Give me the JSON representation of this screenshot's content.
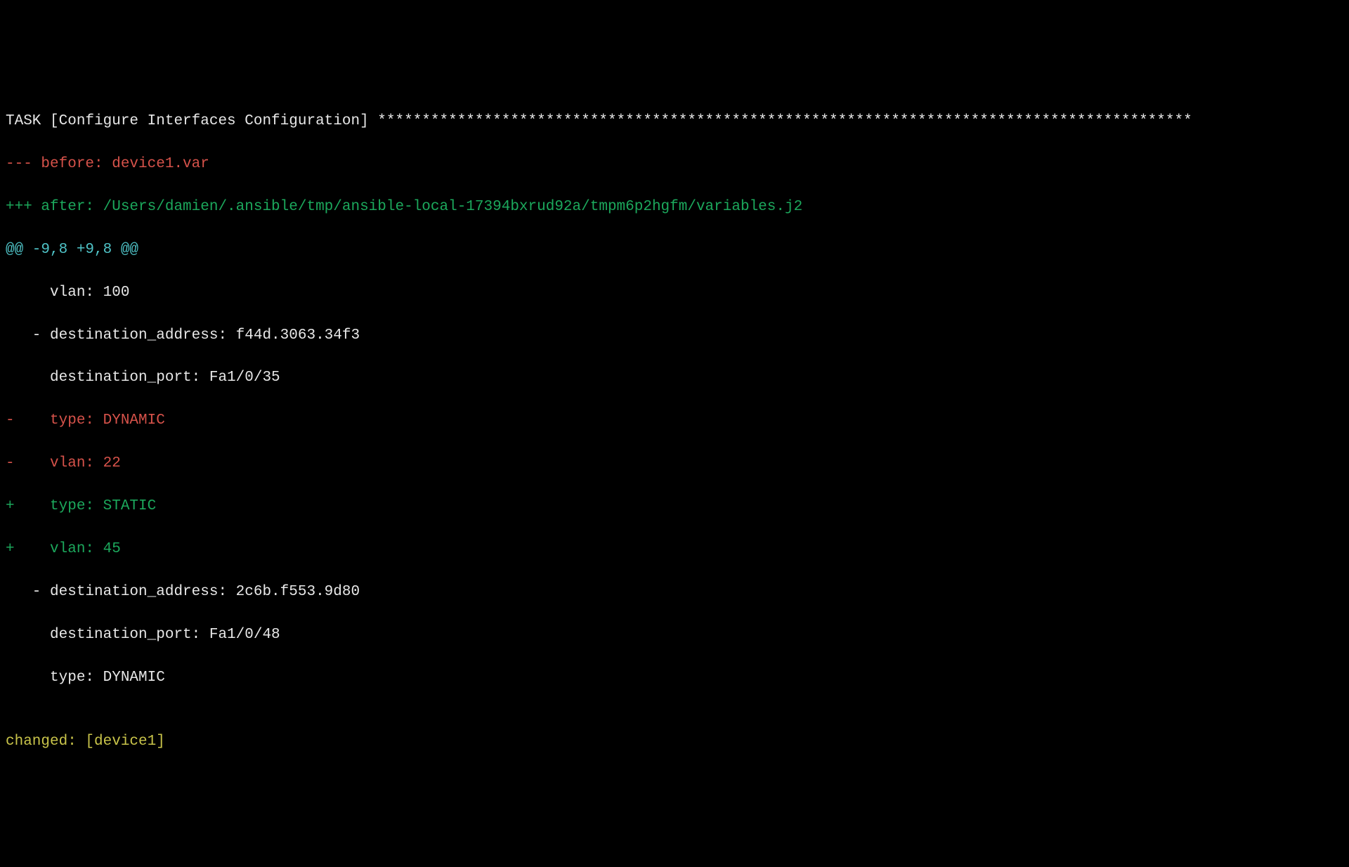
{
  "terminal": {
    "task_header": "TASK [Configure Interfaces Configuration] ********************************************************************************************",
    "diff_before": "--- before: device1.var",
    "diff_after": "+++ after: /Users/damien/.ansible/tmp/ansible-local-17394bxrud92a/tmpm6p2hgfm/variables.j2",
    "hunk_header": "@@ -9,8 +9,8 @@",
    "context1": "     vlan: 100",
    "context2": "   - destination_address: f44d.3063.34f3",
    "context3": "     destination_port: Fa1/0/35",
    "removed1": "-    type: DYNAMIC",
    "removed2": "-    vlan: 22",
    "added1": "+    type: STATIC",
    "added2": "+    vlan: 45",
    "context4": "   - destination_address: 2c6b.f553.9d80",
    "context5": "     destination_port: Fa1/0/48",
    "context6": "     type: DYNAMIC",
    "blank": "",
    "result": "changed: [device1]"
  }
}
